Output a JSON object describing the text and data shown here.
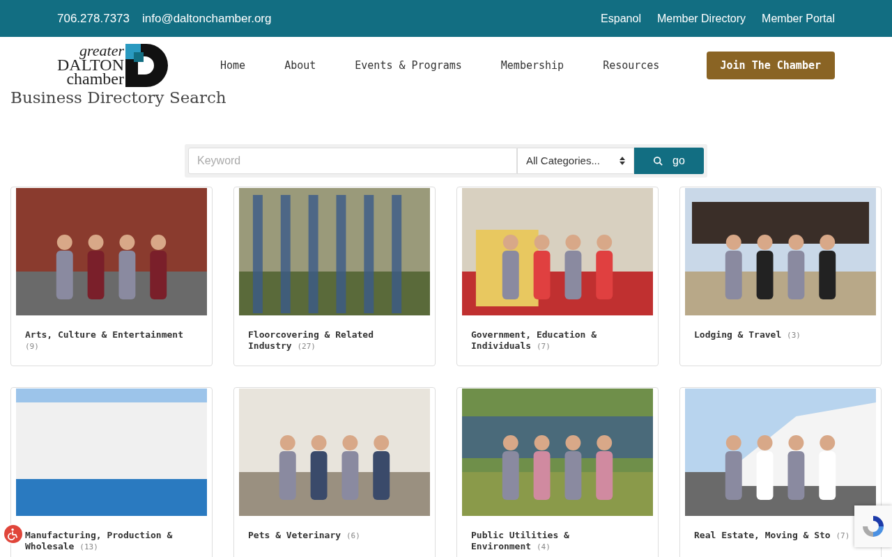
{
  "top_bar": {
    "phone": "706.278.7373",
    "email": "info@daltonchamber.org",
    "links": [
      "Espanol",
      "Member Directory",
      "Member Portal"
    ]
  },
  "logo": {
    "word_1": "greater",
    "word_2": "DALTON",
    "word_3": "chamber"
  },
  "nav": {
    "items": [
      "Home",
      "About",
      "Events & Programs",
      "Membership",
      "Resources"
    ],
    "cta": "Join The Chamber"
  },
  "page_title": "Business Directory Search",
  "search": {
    "placeholder": "Keyword",
    "category": "All Categories...",
    "button": "go"
  },
  "categories": [
    {
      "name": "Arts, Culture & Entertainment",
      "count": "(9)"
    },
    {
      "name": "Floorcovering & Related Industry",
      "count": "(27)"
    },
    {
      "name": "Government, Education & Individuals",
      "count": "(7)"
    },
    {
      "name": "Lodging & Travel",
      "count": "(3)"
    },
    {
      "name": "Manufacturing, Production & Wholesale",
      "count": "(13)"
    },
    {
      "name": "Pets & Veterinary",
      "count": "(6)"
    },
    {
      "name": "Public Utilities & Environment",
      "count": "(4)"
    },
    {
      "name": "Real Estate, Moving & Sto",
      "count": "(7)"
    }
  ]
}
